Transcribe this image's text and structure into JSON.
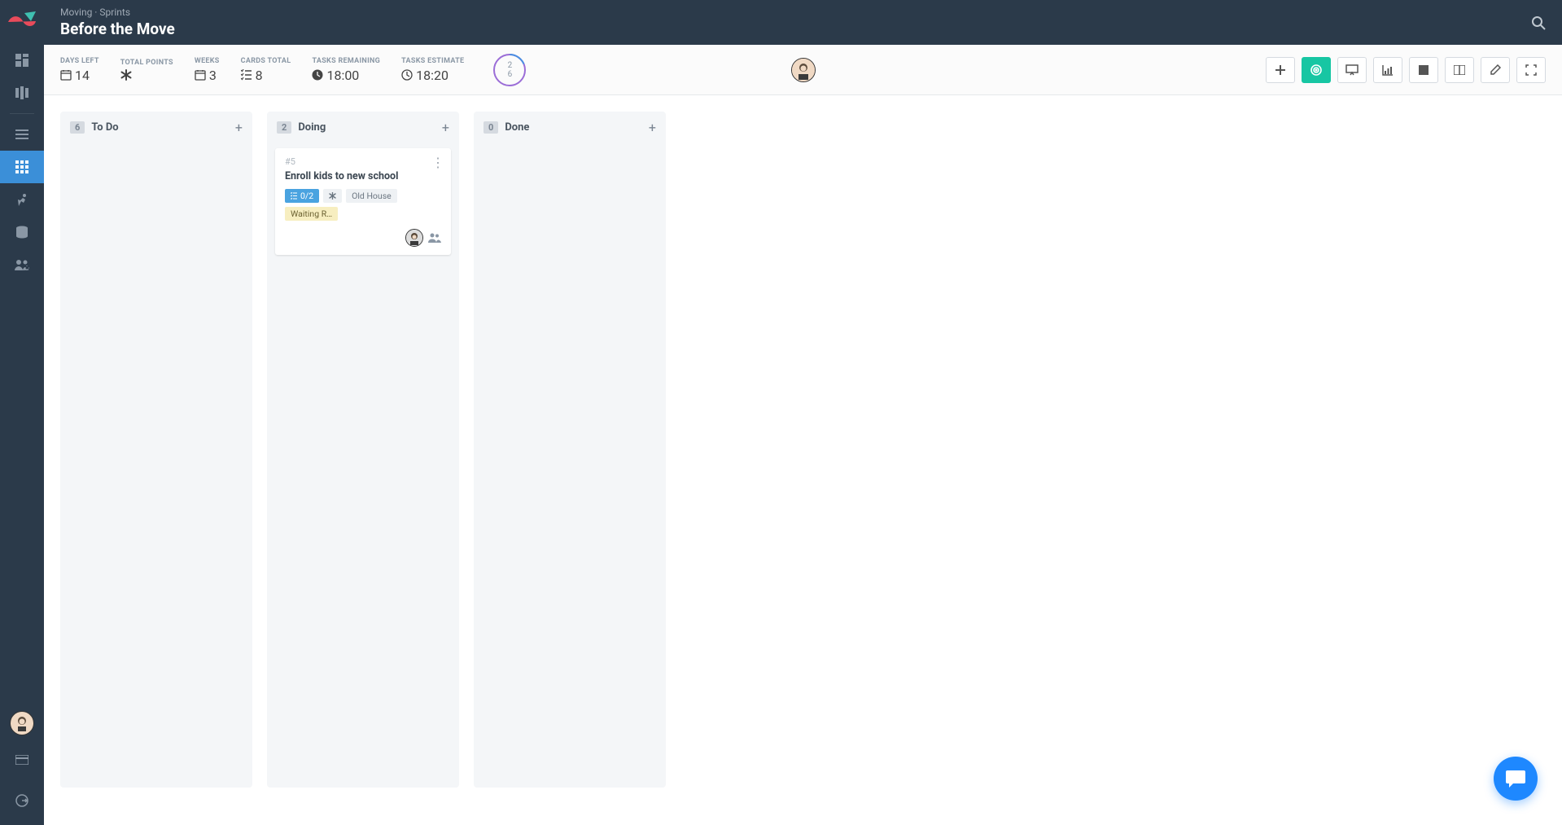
{
  "header": {
    "breadcrumb": "Moving · Sprints",
    "title": "Before the Move"
  },
  "stats": {
    "days_left": {
      "label": "DAYS LEFT",
      "value": "14"
    },
    "total_points": {
      "label": "TOTAL POINTS",
      "value": ""
    },
    "weeks": {
      "label": "WEEKS",
      "value": "3"
    },
    "cards_total": {
      "label": "CARDS TOTAL",
      "value": "8"
    },
    "tasks_remaining": {
      "label": "TASKS REMAINING",
      "value": "18:00"
    },
    "tasks_estimate": {
      "label": "TASKS ESTIMATE",
      "value": "18:20"
    },
    "ring_top": "2",
    "ring_bottom": "6"
  },
  "columns": [
    {
      "count": "6",
      "title": "To Do"
    },
    {
      "count": "2",
      "title": "Doing"
    },
    {
      "count": "0",
      "title": "Done"
    }
  ],
  "card": {
    "id": "#5",
    "title": "Enroll kids to new school",
    "tasks_badge": "0/2",
    "tag_oldhouse": "Old House",
    "tag_waiting": "Waiting R…"
  }
}
